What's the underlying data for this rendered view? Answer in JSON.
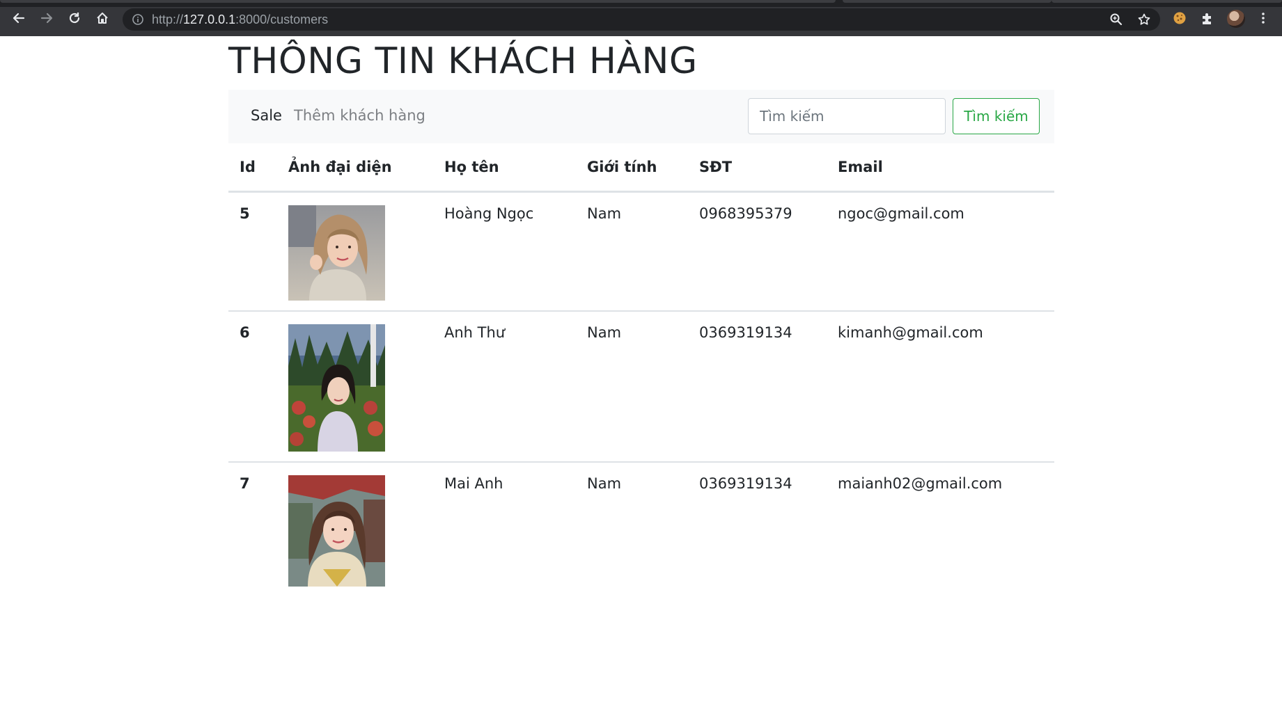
{
  "browser": {
    "url_scheme": "http://",
    "url_host": "127.0.0.1",
    "url_path": ":8000/customers"
  },
  "page": {
    "title": "THÔNG TIN KHÁCH HÀNG"
  },
  "navbar": {
    "brand": "Sale",
    "add_link": "Thêm khách hàng",
    "search_placeholder": "Tìm kiếm",
    "search_button": "Tìm kiếm",
    "search_button_color": "#28a745"
  },
  "table": {
    "headers": [
      "Id",
      "Ảnh đại diện",
      "Họ tên",
      "Giới tính",
      "SĐT",
      "Email"
    ],
    "rows": [
      {
        "id": "5",
        "name": "Hoàng Ngọc",
        "gender": "Nam",
        "phone": "0968395379",
        "email": "ngoc@gmail.com"
      },
      {
        "id": "6",
        "name": "Anh Thư",
        "gender": "Nam",
        "phone": "0369319134",
        "email": "kimanh@gmail.com"
      },
      {
        "id": "7",
        "name": "Mai Anh",
        "gender": "Nam",
        "phone": "0369319134",
        "email": "maianh02@gmail.com"
      }
    ]
  }
}
